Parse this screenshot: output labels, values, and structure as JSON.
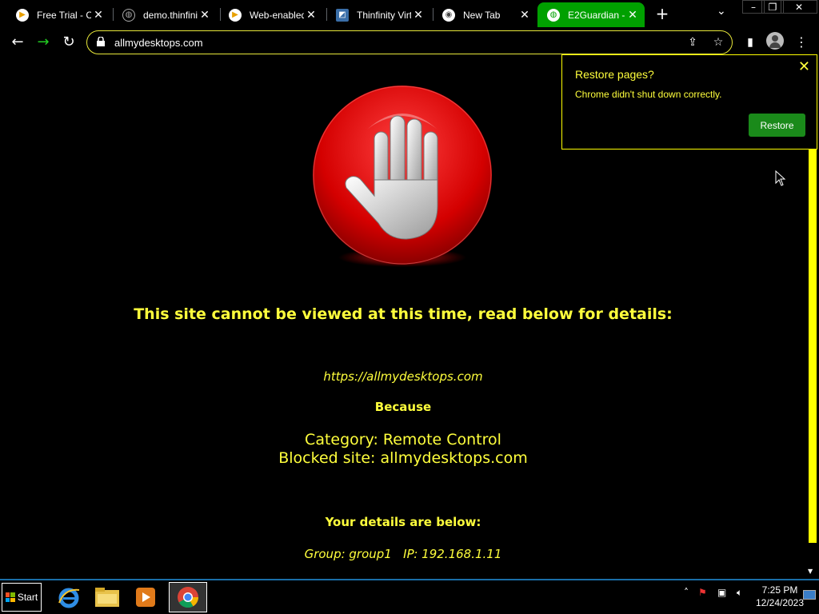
{
  "browser": {
    "tabs": [
      {
        "title": "Free Trial - Cy",
        "favicon": "thinfinity-icon",
        "active": false
      },
      {
        "title": "demo.thinfinity",
        "favicon": "globe-icon",
        "active": false
      },
      {
        "title": "Web-enabled",
        "favicon": "thinfinity-icon",
        "active": false
      },
      {
        "title": "Thinfinity Virtu",
        "favicon": "chart-icon",
        "active": false
      },
      {
        "title": "New Tab",
        "favicon": "chrome-icon",
        "active": false
      },
      {
        "title": "E2Guardian -",
        "favicon": "globe-icon",
        "active": true
      }
    ],
    "address": "allmydesktops.com",
    "active_tab_color": "#00a000"
  },
  "page": {
    "headline": "This site cannot be viewed at this time, read below for details:",
    "blocked_url": "https://allmydesktops.com",
    "because": "Because",
    "category": "Category: Remote Control",
    "blocked_site": "Blocked site: allmydesktops.com",
    "details_title": "Your details are below:",
    "group_line": "Group: group1   IP: 192.168.1.11",
    "text_color": "#ffff3c",
    "background": "#000000"
  },
  "restore_bubble": {
    "title": "Restore pages?",
    "message": "Chrome didn't shut down correctly.",
    "button": "Restore",
    "button_color": "#1a8a1a"
  },
  "taskbar": {
    "start_label": "Start",
    "apps": [
      "internet-explorer-icon",
      "file-explorer-icon",
      "media-player-icon",
      "chrome-icon"
    ],
    "time": "7:25 PM",
    "date": "12/24/2023"
  }
}
